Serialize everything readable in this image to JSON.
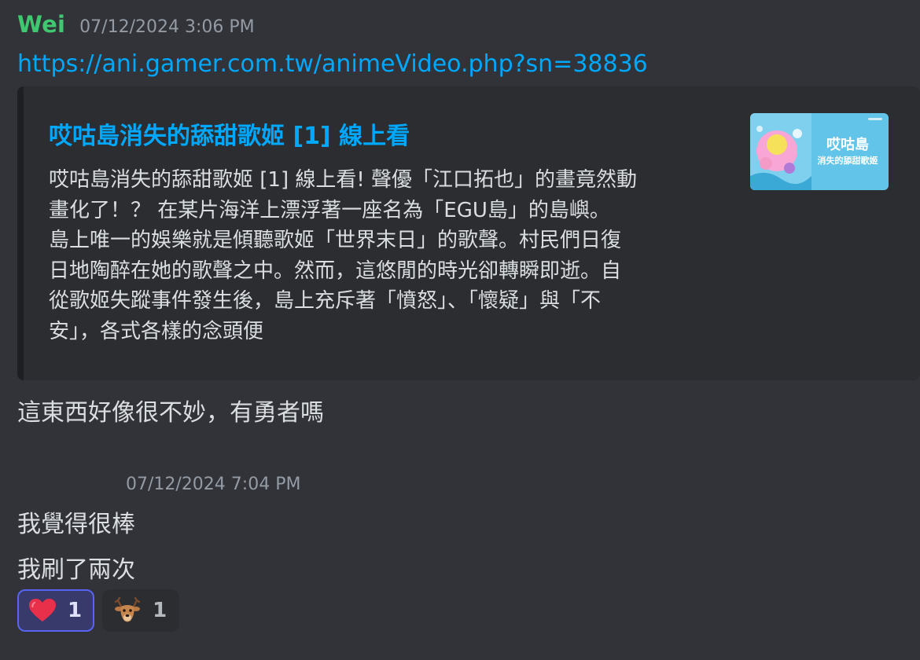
{
  "message1": {
    "username": "Wei",
    "timestamp": "07/12/2024 3:06 PM",
    "link": "https://ani.gamer.com.tw/animeVideo.php?sn=38836",
    "embed": {
      "title": "哎咕島消失的舔甜歌姬 [1] 線上看",
      "description_lines": [
        "哎咕島消失的舔甜歌姬 [1] 線上看! 聲優「江口拓也」的畫竟然動",
        "畫化了！？ 在某片海洋上漂浮著一座名為「EGU島」的島嶼。",
        "島上唯一的娛樂就是傾聽歌姬「世界末日」的歌聲。村民們日復",
        "日地陶醉在她的歌聲之中。然而，這悠閒的時光卻轉瞬即逝。自",
        "從歌姬失蹤事件發生後，島上充斥著「憤怒」、「懷疑」與「不",
        "安」，各式各樣的念頭便"
      ],
      "thumbnail": {
        "title_line1": "哎咕島",
        "title_line2": "消失的舔甜歌姬"
      }
    },
    "text": "這東西好像很不妙，有勇者嗎"
  },
  "message2": {
    "timestamp": "07/12/2024 7:04 PM",
    "lines": [
      "我覺得很棒",
      "我刷了兩次"
    ]
  },
  "reactions": [
    {
      "emoji": "heart",
      "count": "1",
      "active": true
    },
    {
      "emoji": "deer",
      "count": "1",
      "active": false
    }
  ],
  "colors": {
    "background": "#313338",
    "username": "#3fc870",
    "link": "#00a8fc",
    "embed_bg": "#2b2d31",
    "reaction_active_border": "#5865f2"
  }
}
